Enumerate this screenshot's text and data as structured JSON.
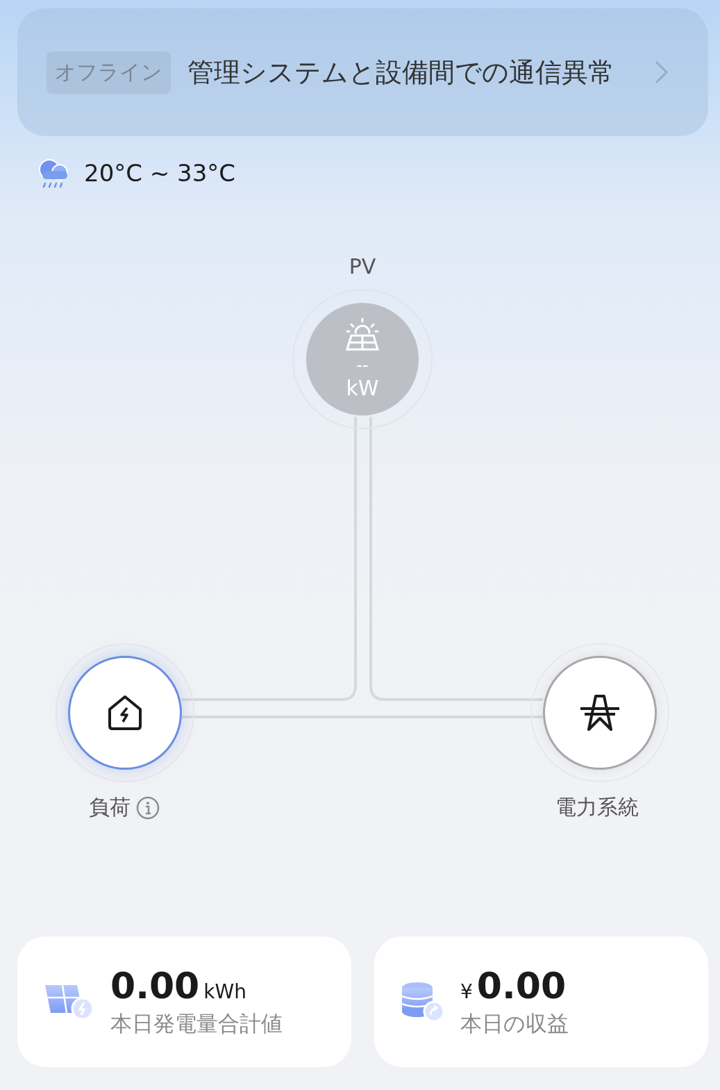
{
  "alert": {
    "badge": "オフライン",
    "message": "管理システムと設備間での通信異常"
  },
  "weather": {
    "range": "20°C ~ 33°C"
  },
  "flow": {
    "pv": {
      "label": "PV",
      "value": "--",
      "unit": "kW",
      "online": false
    },
    "load": {
      "label": "負荷",
      "active": true
    },
    "grid": {
      "label": "電力系統",
      "active": false
    }
  },
  "stats": [
    {
      "kind": "energy",
      "value": "0.00",
      "unit": "kWh",
      "label": "本日発電量合計値"
    },
    {
      "kind": "revenue",
      "currency": "¥",
      "value": "0.00",
      "label": "本日の収益"
    }
  ]
}
